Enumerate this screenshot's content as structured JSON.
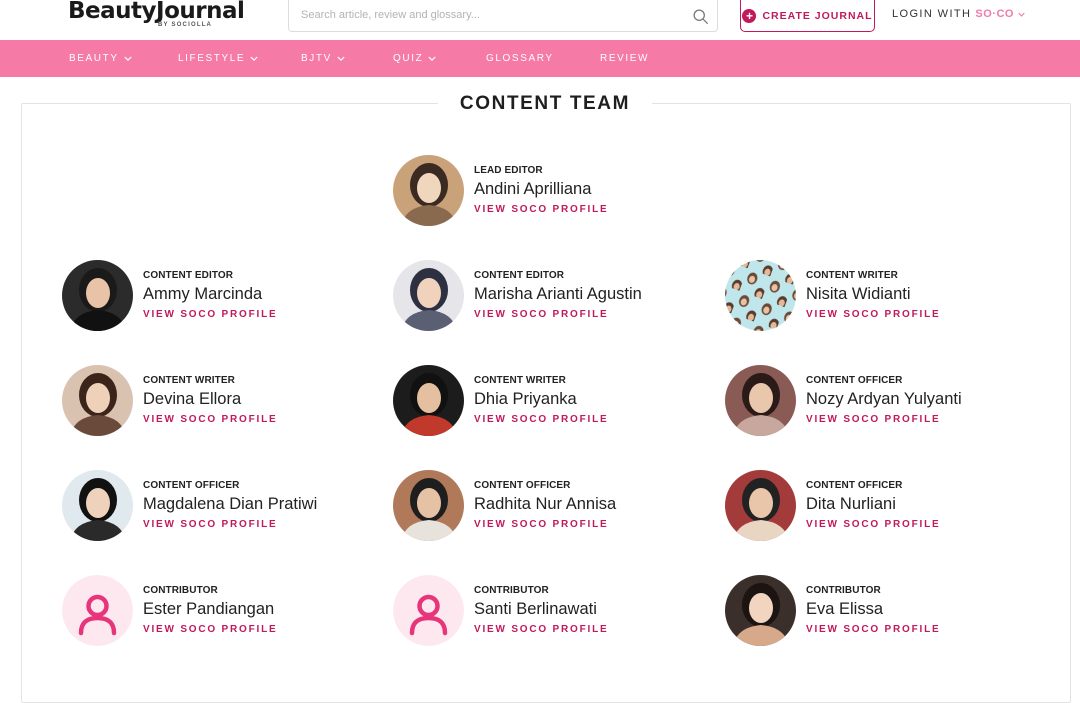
{
  "header": {
    "logo": "BeautyJournal",
    "logo_sub": "BY SOCIOLLA",
    "search_placeholder": "Search article, review and glossary...",
    "create_journal": "CREATE JOURNAL",
    "login_label": "LOGIN WITH",
    "login_brand": "SO·CO"
  },
  "nav": [
    {
      "label": "BEAUTY",
      "dropdown": true
    },
    {
      "label": "LIFESTYLE",
      "dropdown": true
    },
    {
      "label": "BJTV",
      "dropdown": true
    },
    {
      "label": "QUIZ",
      "dropdown": true
    },
    {
      "label": "GLOSSARY",
      "dropdown": false
    },
    {
      "label": "REVIEW",
      "dropdown": false
    }
  ],
  "colors": {
    "accent": "#c01a5c",
    "nav_bg": "#f57aa6"
  },
  "page_title": "CONTENT TEAM",
  "profile_link": "VIEW SOCO PROFILE",
  "members": [
    {
      "role": "LEAD EDITOR",
      "name": "Andini Aprilliana",
      "avatar": "photo"
    },
    {
      "role": "CONTENT EDITOR",
      "name": "Ammy Marcinda",
      "avatar": "photo"
    },
    {
      "role": "CONTENT EDITOR",
      "name": "Marisha Arianti Agustin",
      "avatar": "photo"
    },
    {
      "role": "CONTENT WRITER",
      "name": "Nisita Widianti",
      "avatar": "pattern"
    },
    {
      "role": "CONTENT WRITER",
      "name": "Devina Ellora",
      "avatar": "photo"
    },
    {
      "role": "CONTENT WRITER",
      "name": "Dhia Priyanka",
      "avatar": "photo"
    },
    {
      "role": "CONTENT OFFICER",
      "name": "Nozy Ardyan Yulyanti",
      "avatar": "photo"
    },
    {
      "role": "CONTENT OFFICER",
      "name": "Magdalena Dian Pratiwi",
      "avatar": "photo"
    },
    {
      "role": "CONTENT OFFICER",
      "name": "Radhita Nur Annisa",
      "avatar": "photo"
    },
    {
      "role": "CONTENT OFFICER",
      "name": "Dita Nurliani",
      "avatar": "photo"
    },
    {
      "role": "CONTRIBUTOR",
      "name": "Ester Pandiangan",
      "avatar": "default-user-icon"
    },
    {
      "role": "CONTRIBUTOR",
      "name": "Santi Berlinawati",
      "avatar": "default-user-icon"
    },
    {
      "role": "CONTRIBUTOR",
      "name": "Eva Elissa",
      "avatar": "photo"
    }
  ]
}
